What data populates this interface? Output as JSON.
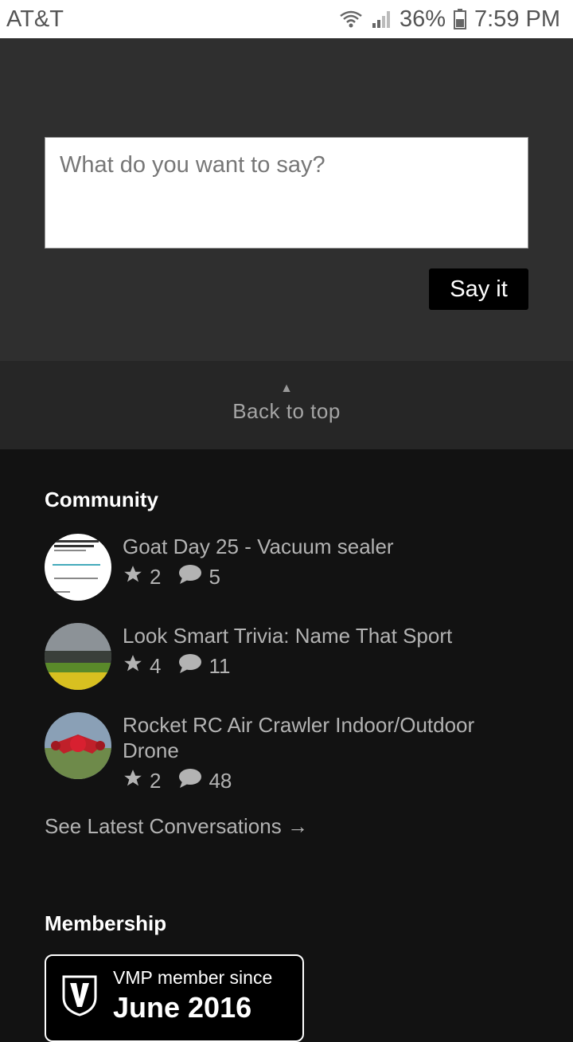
{
  "status_bar": {
    "carrier": "AT&T",
    "battery": "36%",
    "time": "7:59 PM"
  },
  "comment": {
    "placeholder": "What do you want to say?",
    "submit_label": "Say it"
  },
  "back_to_top": {
    "arrow": "▲",
    "label": "Back to top"
  },
  "community": {
    "title": "Community",
    "items": [
      {
        "title": "Goat Day 25 - Vacuum sealer",
        "stars": "2",
        "comments": "5"
      },
      {
        "title": "Look Smart Trivia: Name That Sport",
        "stars": "4",
        "comments": "11"
      },
      {
        "title": "Rocket RC Air Crawler Indoor/Outdoor Drone",
        "stars": "2",
        "comments": "48"
      }
    ],
    "see_latest": "See Latest Conversations →"
  },
  "membership": {
    "title": "Membership",
    "since_label": "VMP member since",
    "since_date": "June 2016"
  },
  "colors": {
    "accent_text": "#b3b3b3",
    "footer_bg": "#121212",
    "comment_bg": "#2f2f2f"
  }
}
